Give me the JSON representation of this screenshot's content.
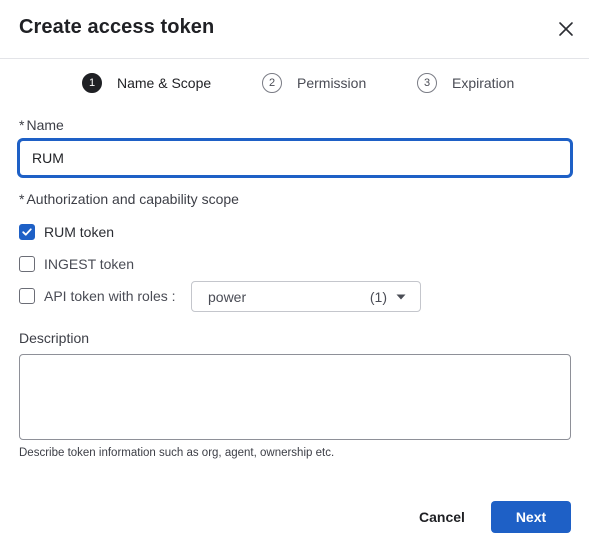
{
  "dialog": {
    "title": "Create access token"
  },
  "stepper": {
    "steps": [
      {
        "number": "1",
        "label": "Name & Scope",
        "active": true
      },
      {
        "number": "2",
        "label": "Permission",
        "active": false
      },
      {
        "number": "3",
        "label": "Expiration",
        "active": false
      }
    ]
  },
  "form": {
    "name_required_mark": "*",
    "name_label": "Name",
    "name_value": "RUM",
    "scope_required_mark": "*",
    "scope_label": "Authorization and capability scope",
    "scopes": [
      {
        "label": "RUM token",
        "checked": true
      },
      {
        "label": "INGEST token",
        "checked": false
      },
      {
        "label": "API token with roles :",
        "checked": false
      }
    ],
    "roles_select": {
      "value": "power",
      "count": "(1)"
    },
    "description_label": "Description",
    "description_value": "",
    "description_hint": "Describe token information such as org, agent, ownership etc."
  },
  "footer": {
    "cancel_label": "Cancel",
    "next_label": "Next"
  },
  "colors": {
    "accent": "#1e60c6",
    "text": "#2b2d33",
    "border": "#c4c6cc"
  },
  "icons": {
    "close": "close-icon",
    "check": "checkmark-icon",
    "dropdown": "caret-down-icon"
  }
}
